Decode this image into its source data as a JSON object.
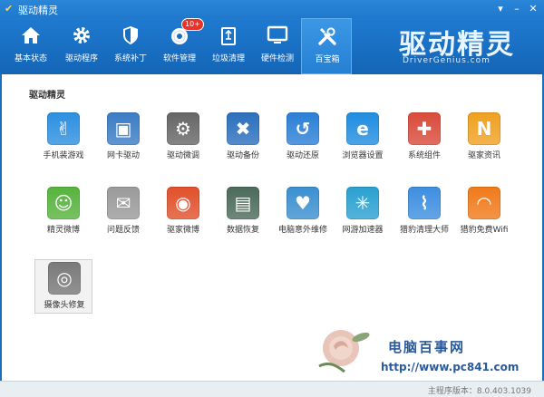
{
  "window": {
    "title": "驱动精灵"
  },
  "nav": [
    {
      "label": "基本状态",
      "icon": "home-icon"
    },
    {
      "label": "驱动程序",
      "icon": "gear-icon"
    },
    {
      "label": "系统补丁",
      "icon": "shield-icon"
    },
    {
      "label": "软件管理",
      "icon": "disc-icon",
      "badge": "10+"
    },
    {
      "label": "垃圾清理",
      "icon": "recycle-bin-icon"
    },
    {
      "label": "硬件检测",
      "icon": "monitor-icon"
    },
    {
      "label": "百宝箱",
      "icon": "tools-icon",
      "active": true
    }
  ],
  "brand": {
    "cn": "驱动精灵",
    "en": "DriverGenius.com"
  },
  "content": {
    "section_title": "驱动精灵",
    "tools": [
      {
        "label": "手机装游戏",
        "icon": "mobile-game-icon",
        "color": "#2c8fe0"
      },
      {
        "label": "网卡驱动",
        "icon": "network-card-icon",
        "color": "#3a7cc4"
      },
      {
        "label": "驱动微调",
        "icon": "gears-icon",
        "color": "#666666"
      },
      {
        "label": "驱动备份",
        "icon": "wrench-screwdriver-icon",
        "color": "#2a6fbd"
      },
      {
        "label": "驱动还原",
        "icon": "restore-icon",
        "color": "#2a7fd6"
      },
      {
        "label": "浏览器设置",
        "icon": "ie-browser-icon",
        "color": "#1f8de0"
      },
      {
        "label": "系统组件",
        "icon": "components-icon",
        "color": "#d94a3a"
      },
      {
        "label": "驱家资讯",
        "icon": "news-icon",
        "color": "#f0a020"
      },
      {
        "label": "精灵微博",
        "icon": "chat-icon",
        "color": "#56b33c"
      },
      {
        "label": "问题反馈",
        "icon": "envelope-icon",
        "color": "#9a9a9a"
      },
      {
        "label": "驱家微博",
        "icon": "weibo-icon",
        "color": "#e1502a"
      },
      {
        "label": "数据恢复",
        "icon": "data-recovery-icon",
        "color": "#4a6a5a"
      },
      {
        "label": "电脑意外维修",
        "icon": "repair-heart-icon",
        "color": "#3b8fd0"
      },
      {
        "label": "网游加速器",
        "icon": "fan-icon",
        "color": "#2aa0d0"
      },
      {
        "label": "猎豹清理大师",
        "icon": "broom-icon",
        "color": "#3d8ee0"
      },
      {
        "label": "猎豹免费Wifi",
        "icon": "wifi-icon",
        "color": "#f07a1a"
      },
      {
        "label": "摄像头修复",
        "icon": "webcam-icon",
        "color": "#7a7a7a",
        "selected": true
      }
    ]
  },
  "watermark": {
    "line1": "电脑百事网",
    "line2": "http://www.pc841.com"
  },
  "status": {
    "version": "主程序版本：8.0.403.1039"
  }
}
